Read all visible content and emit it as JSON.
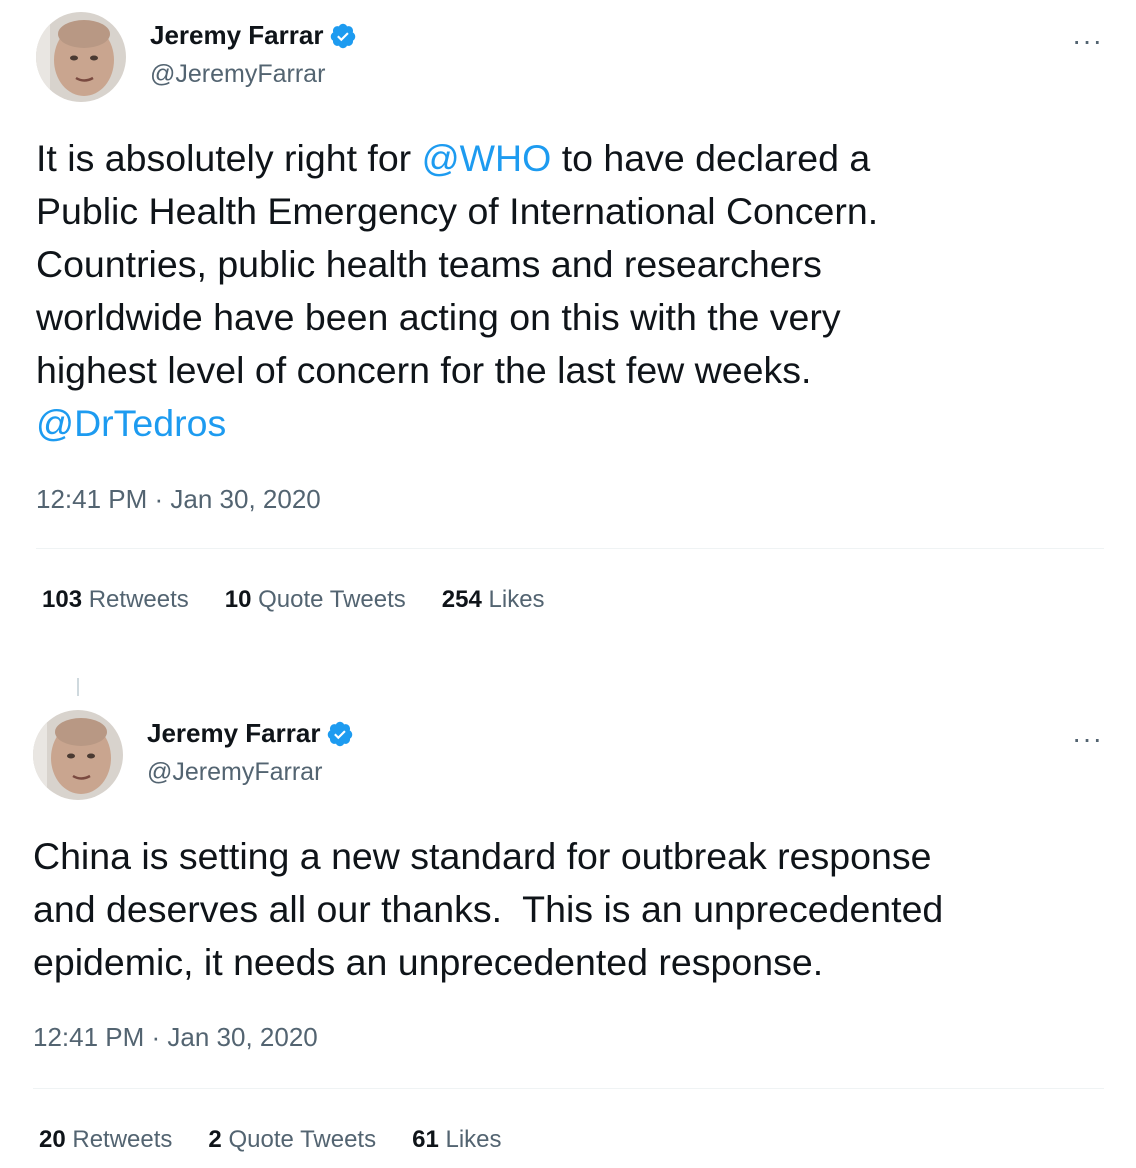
{
  "tweets": [
    {
      "author": {
        "name": "Jeremy Farrar",
        "handle": "@JeremyFarrar",
        "verified": true
      },
      "text": {
        "part1": "It is absolutely right for ",
        "mention1": "@WHO",
        "part2": " to have declared a\nPublic Health Emergency of International Concern.\nCountries, public health teams and researchers\nworldwide have been acting on this with the very\nhighest level of concern for the last few weeks.\n",
        "mention2": "@DrTedros"
      },
      "timestamp": "12:41 PM · Jan 30, 2020",
      "stats": {
        "retweets_count": "103",
        "retweets_label": "Retweets",
        "quotes_count": "10",
        "quotes_label": "Quote Tweets",
        "likes_count": "254",
        "likes_label": "Likes"
      },
      "more_label": "···"
    },
    {
      "author": {
        "name": "Jeremy Farrar",
        "handle": "@JeremyFarrar",
        "verified": true
      },
      "text": {
        "full": "China is setting a new standard for outbreak response\nand deserves all our thanks.  This is an unprecedented\nepidemic, it needs an unprecedented response."
      },
      "timestamp": "12:41 PM · Jan 30, 2020",
      "stats": {
        "retweets_count": "20",
        "retweets_label": "Retweets",
        "quotes_count": "2",
        "quotes_label": "Quote Tweets",
        "likes_count": "61",
        "likes_label": "Likes"
      },
      "more_label": "···"
    }
  ],
  "colors": {
    "accent": "#1d9bf0",
    "text": "#0f1419",
    "secondary": "#536471",
    "divider": "#eff3f4"
  }
}
